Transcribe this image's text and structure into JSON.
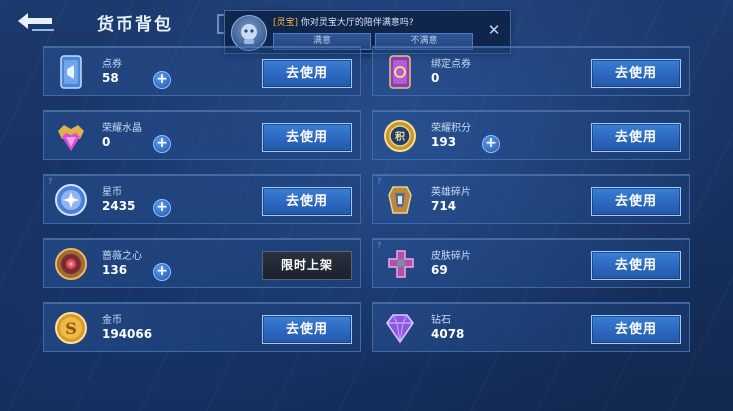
{
  "header": {
    "title": "货币背包"
  },
  "popup": {
    "tag": "[灵宝]",
    "message": "你对灵宝大厅的陪伴满意吗?",
    "yes_label": "满意",
    "no_label": "不满意",
    "close_glyph": "✕"
  },
  "help_glyph": "?",
  "plus_glyph": "+",
  "items": [
    {
      "name": "点券",
      "value": "58",
      "action": "去使用",
      "icon": "voucher-card-icon"
    },
    {
      "name": "绑定点券",
      "value": "0",
      "action": "去使用",
      "icon": "bound-voucher-card-icon"
    },
    {
      "name": "荣耀水晶",
      "value": "0",
      "action": "去使用",
      "icon": "glory-crystal-icon"
    },
    {
      "name": "荣耀积分",
      "value": "193",
      "action": "去使用",
      "icon": "glory-points-icon"
    },
    {
      "name": "星币",
      "value": "2435",
      "action": "去使用",
      "icon": "star-coin-icon"
    },
    {
      "name": "英雄碎片",
      "value": "714",
      "action": "去使用",
      "icon": "hero-fragment-icon"
    },
    {
      "name": "蔷薇之心",
      "value": "136",
      "action": "限时上架",
      "icon": "rose-heart-icon"
    },
    {
      "name": "皮肤碎片",
      "value": "69",
      "action": "去使用",
      "icon": "skin-fragment-icon"
    },
    {
      "name": "金币",
      "value": "194066",
      "action": "去使用",
      "icon": "gold-coin-icon"
    },
    {
      "name": "钻石",
      "value": "4078",
      "action": "去使用",
      "icon": "diamond-icon"
    }
  ],
  "colors": {
    "accent_button": "#2a66bd",
    "popup_tag": "#f0b64a",
    "background": "#173160"
  }
}
